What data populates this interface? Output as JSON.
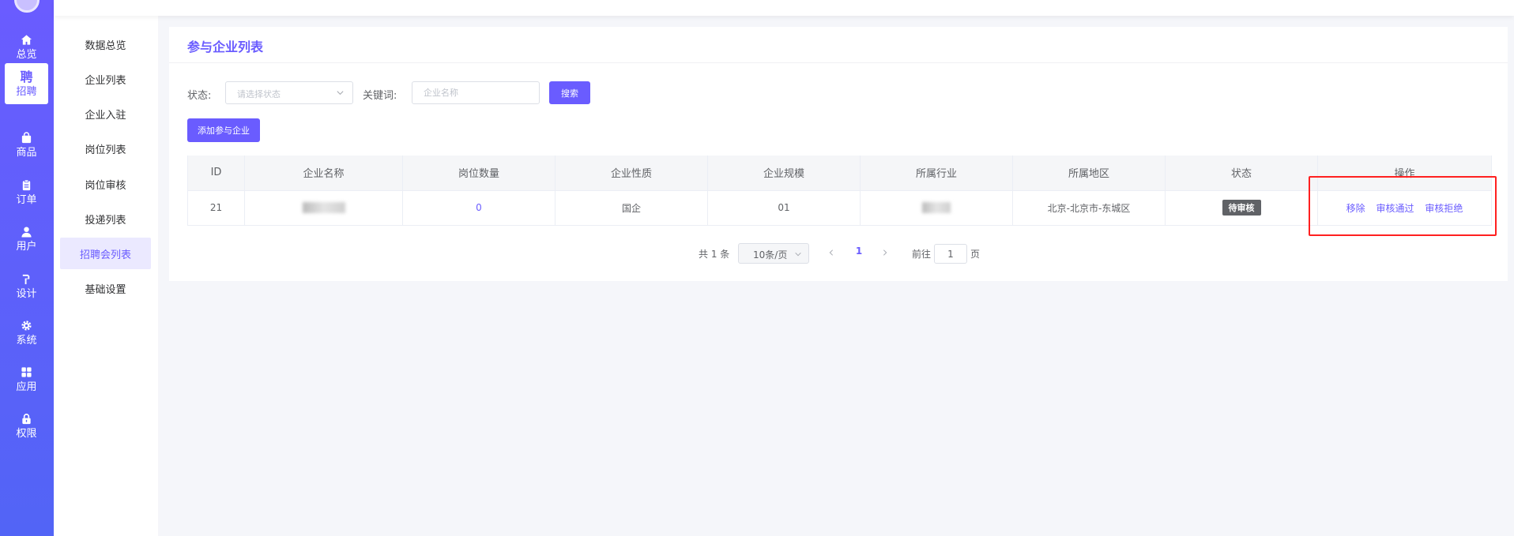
{
  "rail": {
    "items": [
      {
        "label": "总览",
        "icon": "home-icon"
      },
      {
        "label": "招聘",
        "icon": "recruit-icon",
        "glyph": "聘",
        "active": true
      },
      {
        "label": "商品",
        "icon": "bag-icon"
      },
      {
        "label": "订单",
        "icon": "clipboard-icon"
      },
      {
        "label": "用户",
        "icon": "user-icon"
      },
      {
        "label": "设计",
        "icon": "brush-icon"
      },
      {
        "label": "系统",
        "icon": "gear-icon"
      },
      {
        "label": "应用",
        "icon": "grid-icon"
      },
      {
        "label": "权限",
        "icon": "lock-icon"
      }
    ]
  },
  "submenu": {
    "items": [
      {
        "label": "数据总览"
      },
      {
        "label": "企业列表"
      },
      {
        "label": "企业入驻"
      },
      {
        "label": "岗位列表"
      },
      {
        "label": "岗位审核"
      },
      {
        "label": "投递列表"
      },
      {
        "label": "招聘会列表",
        "active": true
      },
      {
        "label": "基础设置"
      }
    ]
  },
  "card": {
    "title": "参与企业列表"
  },
  "filters": {
    "status_label": "状态:",
    "status_placeholder": "请选择状态",
    "keyword_label": "关键词:",
    "keyword_placeholder": "企业名称",
    "search_button": "搜索",
    "add_button": "添加参与企业"
  },
  "table": {
    "headers": [
      "ID",
      "企业名称",
      "岗位数量",
      "企业性质",
      "企业规模",
      "所属行业",
      "所属地区",
      "状态",
      "操作"
    ],
    "rows": [
      {
        "id": "21",
        "company_name": "",
        "job_count": "0",
        "nature": "国企",
        "scale": "01",
        "industry": "",
        "region": "北京-北京市-东城区",
        "status": "待审核",
        "actions": [
          "移除",
          "审核通过",
          "审核拒绝"
        ]
      }
    ]
  },
  "pagination": {
    "total": "共 1 条",
    "page_size": "10条/页",
    "current_page": "1",
    "goto_prefix": "前往",
    "goto_value": "1",
    "goto_suffix": "页"
  },
  "colors": {
    "accent": "#6a5cff",
    "highlight": "#ff2020"
  }
}
